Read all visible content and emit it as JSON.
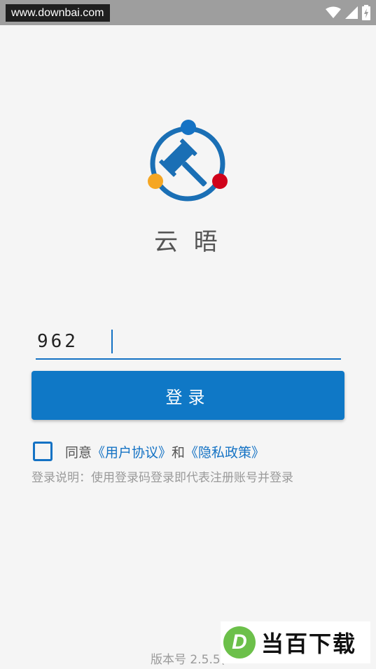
{
  "status_bar": {
    "watermark": "www.downbai.com",
    "icons": [
      "wifi-icon",
      "signal-icon",
      "battery-charging-icon"
    ]
  },
  "app": {
    "name": "云 晤",
    "logo": "gavel-logo-icon",
    "colors": {
      "primary": "#0f78c6",
      "dot_blue": "#1472c4",
      "dot_orange": "#f5a623",
      "dot_red": "#d0021b"
    }
  },
  "login": {
    "code_value": "962",
    "button_label": "登录"
  },
  "agreement": {
    "prefix": "同意",
    "user_agreement": "《用户协议》",
    "and": "和",
    "privacy_policy": "《隐私政策》",
    "note": "登录说明：使用登录码登录即代表注册账号并登录"
  },
  "footer": {
    "version": "版本号 2.5.5("
  },
  "brand_overlay": {
    "letter": "D",
    "text": "当百下载"
  }
}
